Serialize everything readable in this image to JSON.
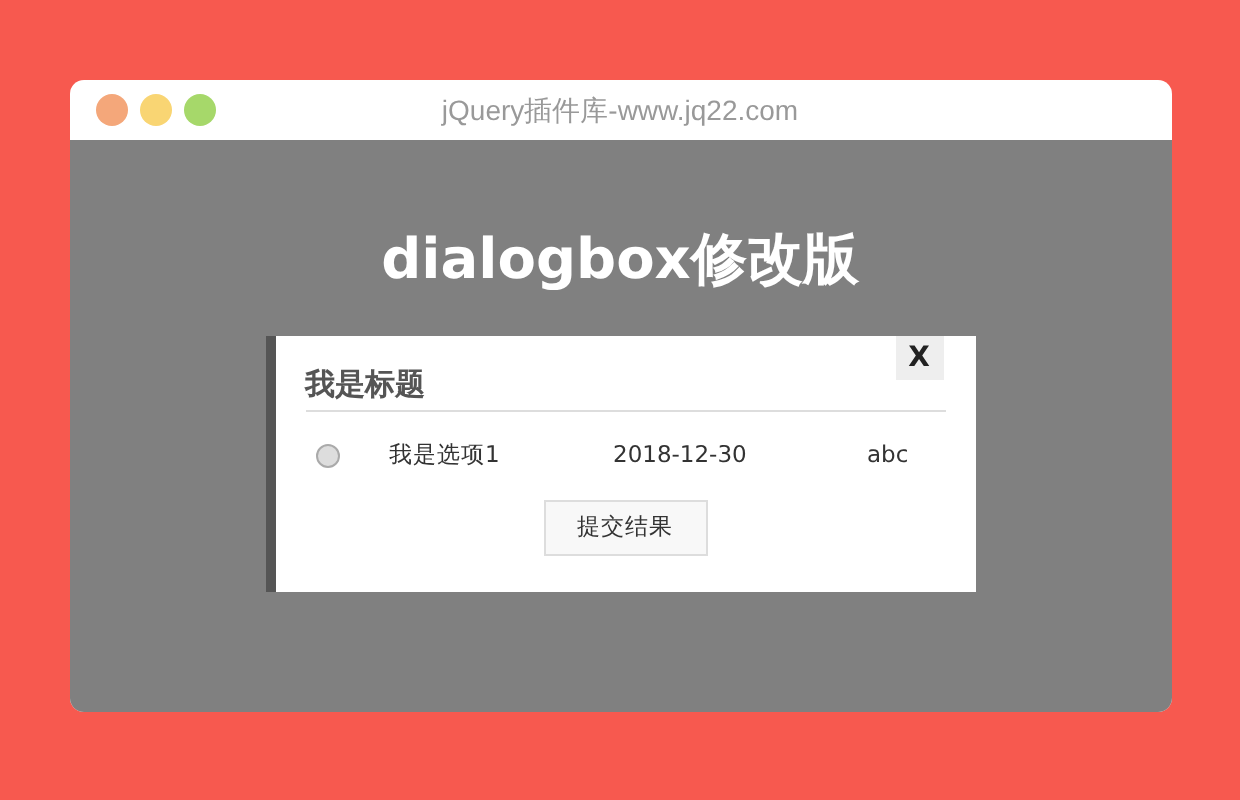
{
  "window": {
    "title": "jQuery插件库-www.jq22.com"
  },
  "page": {
    "heading": "dialogbox修改版"
  },
  "dialog": {
    "close": "X",
    "title": "我是标题",
    "rows": [
      {
        "selected": false,
        "name": "我是选项1",
        "date": "2018-12-30",
        "column_3": "abc"
      }
    ],
    "submit": "提交结果"
  }
}
